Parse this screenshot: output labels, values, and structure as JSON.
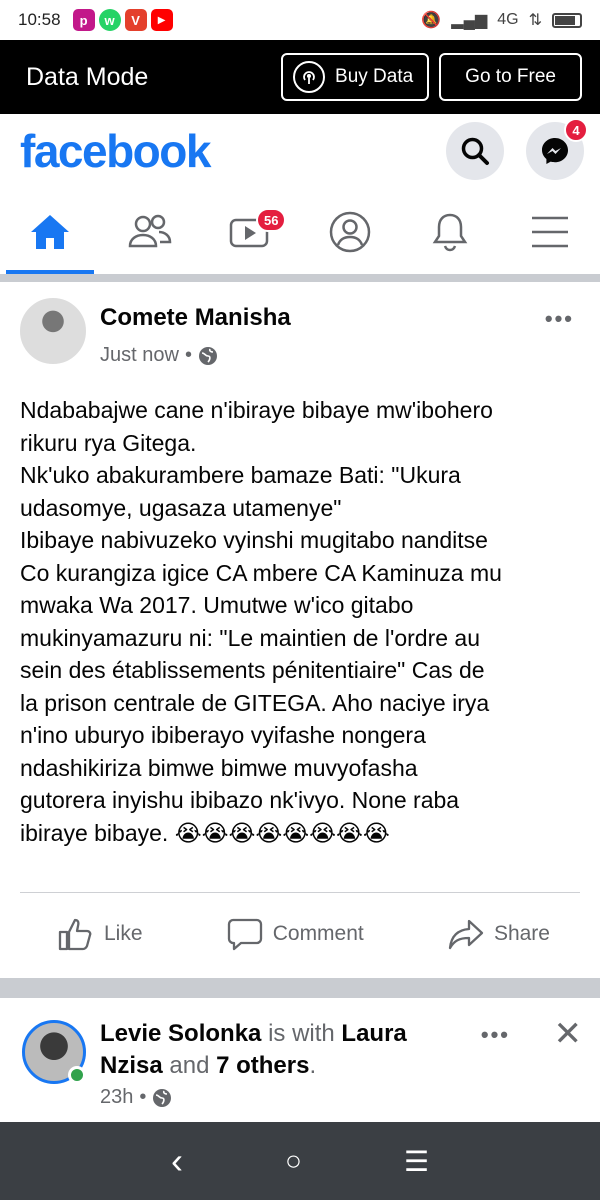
{
  "status_bar": {
    "time": "10:58",
    "network": "4G",
    "apps": [
      {
        "name": "p",
        "color": "#c2188a"
      },
      {
        "name": "w",
        "color": "#25d366"
      },
      {
        "name": "V",
        "color": "#e4402c"
      },
      {
        "name": "▶",
        "color": "#ff0000"
      }
    ]
  },
  "data_mode": {
    "title": "Data Mode",
    "buy_label": "Buy Data",
    "free_label": "Go to Free"
  },
  "header": {
    "logo": "facebook",
    "messenger_badge": "4"
  },
  "nav": {
    "video_badge": "56"
  },
  "post": {
    "author": "Comete Manisha",
    "time": "Just now",
    "separator": "•",
    "more": "•••",
    "text": "Ndababajwe cane n'ibiraye bibaye mw'ibohero\nrikuru rya Gitega.\nNk'uko abakurambere bamaze Bati: \"Ukura\nudasomye, ugasaza utamenye\"\nIbibaye nabivuzeko vyinshi mugitabo nanditse\nCo kurangiza igice CA mbere CA Kaminuza mu\nmwaka Wa 2017. Umutwe w'ico gitabo\nmukinyamazuru ni: \"Le maintien de l'ordre au\nsein des établissements pénitentiaire\" Cas de\nla prison centrale de GITEGA. Aho naciye irya\nn'ino uburyo ibiberayo vyifashe nongera\nndashikiriza bimwe bimwe muvyofasha\ngutorera inyishu ibibazo nk'ivyo. None raba\nibiraye bibaye. 😭😭😭😭😭😭😭😭",
    "actions": {
      "like": "Like",
      "comment": "Comment",
      "share": "Share"
    }
  },
  "post2": {
    "author": "Levie Solonka",
    "with_text": "is with",
    "tagged": "Laura Nzisa",
    "and_text": "and",
    "others": "7 others",
    "period": ".",
    "time": "23h",
    "separator": "•",
    "more": "•••",
    "close": "✕"
  },
  "android_nav": {
    "back": "‹",
    "home": "○",
    "menu": "☰"
  },
  "colors": {
    "brand": "#1877f2",
    "badge": "#e41e3f",
    "online": "#31a24c"
  }
}
